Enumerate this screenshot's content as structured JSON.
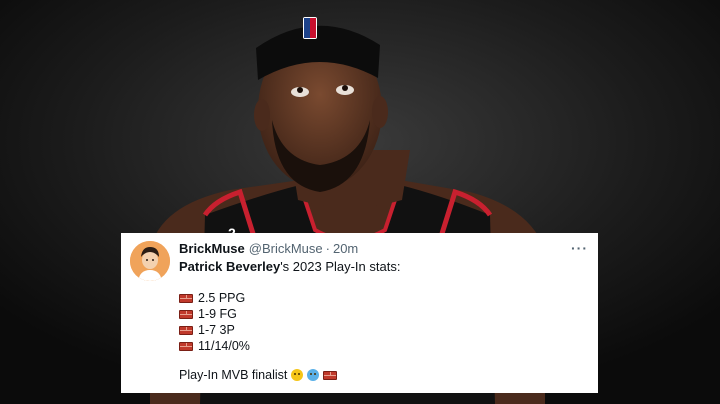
{
  "tweet": {
    "display_name": "BrickMuse",
    "handle": "@BrickMuse",
    "separator": "·",
    "time": "20m",
    "more_label": "···",
    "player_name": "Patrick Beverley",
    "intro_suffix": "'s 2023 Play-In stats:",
    "stats": [
      "2.5 PPG",
      "1-9 FG",
      "1-7 3P",
      "11/14/0%"
    ],
    "finalist_text": "Play-In MVB finalist"
  },
  "icons": {
    "stat_icon": "brick-icon",
    "emojis": [
      "face-with-steam-icon",
      "cold-face-icon",
      "brick-icon"
    ]
  },
  "colors": {
    "card_bg": "#ffffff",
    "text": "#0f1419",
    "muted": "#536471",
    "jersey_red": "#c8202f",
    "background": "#141414"
  }
}
